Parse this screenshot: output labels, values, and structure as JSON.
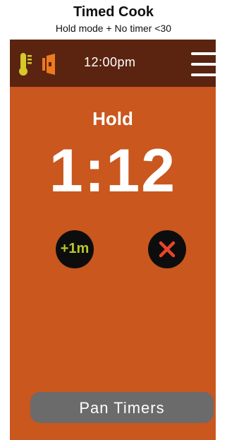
{
  "caption": {
    "title": "Timed Cook",
    "subtitle": "Hold mode + No timer <30"
  },
  "header": {
    "time": "12:00pm",
    "icons": [
      "thermometer-icon",
      "door-icon",
      "menu-icon"
    ]
  },
  "main": {
    "mode_label": "Hold",
    "timer_value": "1:12",
    "add_minute_label": "+1m",
    "cancel_icon": "close-icon"
  },
  "footer": {
    "pan_timers_label": "Pan Timers"
  },
  "colors": {
    "background": "#c9571e",
    "header": "#5a2410",
    "accent_yellow": "#d6c92b",
    "accent_orange": "#ee7a1e",
    "cancel_red": "#e8452b",
    "button_gray": "#6b6b6b"
  }
}
